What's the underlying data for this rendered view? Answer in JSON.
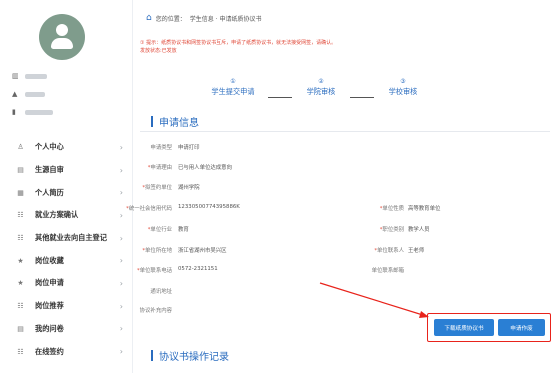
{
  "sidebar": {
    "menu": [
      {
        "icon": "user-icon",
        "glyph": "♙",
        "label": "个人中心"
      },
      {
        "icon": "resume-icon",
        "glyph": "▤",
        "label": "生源自审"
      },
      {
        "icon": "document-icon",
        "glyph": "▦",
        "label": "个人简历"
      },
      {
        "icon": "list-icon",
        "glyph": "☷",
        "label": "就业方案确认"
      },
      {
        "icon": "list-icon",
        "glyph": "☷",
        "label": "其他就业去向自主登记"
      },
      {
        "icon": "star-icon",
        "glyph": "★",
        "label": "岗位收藏"
      },
      {
        "icon": "star-icon",
        "glyph": "★",
        "label": "岗位申请"
      },
      {
        "icon": "list-icon",
        "glyph": "☷",
        "label": "岗位推荐"
      },
      {
        "icon": "doc-icon",
        "glyph": "▤",
        "label": "我的问卷"
      },
      {
        "icon": "list-icon",
        "glyph": "☷",
        "label": "在线签约"
      }
    ],
    "chevron": "›"
  },
  "breadcrumb": {
    "prefix": "您的位置：",
    "path": "学生信息 · 申请纸质协议书"
  },
  "notice": {
    "line1": "① 提示：纸质协议书和网签协议书互斥，申请了纸质协议书，就无法接受网签，请确认。",
    "line2": "发放状态:已发放"
  },
  "steps": [
    {
      "num": "①",
      "label": "学生提交申请"
    },
    {
      "num": "②",
      "label": "学院审核"
    },
    {
      "num": "③",
      "label": "学校审核"
    }
  ],
  "sections": {
    "apply_info": "申请信息",
    "records": "协议书操作记录"
  },
  "fields_left": [
    {
      "label": "申请类型",
      "required": false,
      "value": "申请打印"
    },
    {
      "label": "申请理由",
      "required": true,
      "value": "已与用人单位达成意向"
    },
    {
      "label": "拟签约单位",
      "required": true,
      "value": "湖州学院"
    },
    {
      "label": "统一社会信用代码",
      "required": true,
      "value": "12330500774395886K"
    },
    {
      "label": "单位行业",
      "required": true,
      "value": "教育"
    },
    {
      "label": "单位所在地",
      "required": true,
      "value": "浙江省湖州市吴兴区"
    },
    {
      "label": "单位联系电话",
      "required": true,
      "value": "0572-2321151"
    },
    {
      "label": "通讯地址",
      "required": false,
      "value": ""
    },
    {
      "label": "协议补充内容",
      "required": false,
      "value": ""
    }
  ],
  "fields_right": [
    {
      "label": "单位性质",
      "required": true,
      "value": "高等教育单位"
    },
    {
      "label": "职位类别",
      "required": true,
      "value": "教学人员"
    },
    {
      "label": "单位联系人",
      "required": true,
      "value": "王老师"
    },
    {
      "label": "单位联系邮箱",
      "required": false,
      "value": ""
    }
  ],
  "buttons": {
    "download": "下载纸质协议书",
    "cancel": "申请作废"
  },
  "colors": {
    "accent": "#2a6cbf",
    "button": "#2a7fd4",
    "warning": "#e04a3a",
    "highlight": "#e8231b"
  }
}
